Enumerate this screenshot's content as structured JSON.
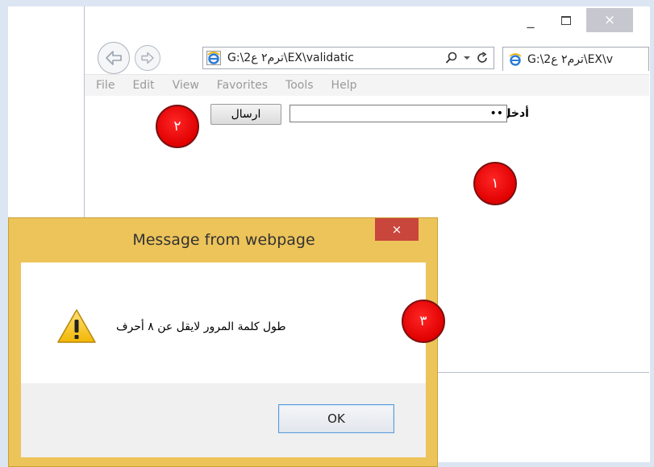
{
  "window": {
    "minimize_label": "_",
    "close_label": "×"
  },
  "nav": {
    "address": "G:\\ترم٢ ع2\\EX\\validatic",
    "tab_title": "G:\\ترم٢ ع2\\EX\\v"
  },
  "menu": [
    "File",
    "Edit",
    "View",
    "Favorites",
    "Tools",
    "Help"
  ],
  "form": {
    "password_label": "أدخل كلمة المرور",
    "password_value": "••",
    "send_label": "ارسال"
  },
  "markers": [
    "١",
    "٢",
    "٣"
  ],
  "dialog": {
    "title": "Message from webpage",
    "close_label": "×",
    "message": "طول كلمة المرور لايقل عن ٨ أحرف",
    "ok_label": "OK"
  },
  "colors": {
    "dialog_frame": "#edc45a",
    "marker_red": "#e00000",
    "close_red": "#c9463d"
  },
  "icons": [
    "back-arrow-icon",
    "forward-arrow-icon",
    "ie-icon",
    "search-icon",
    "refresh-icon",
    "warning-icon",
    "close-icon"
  ]
}
